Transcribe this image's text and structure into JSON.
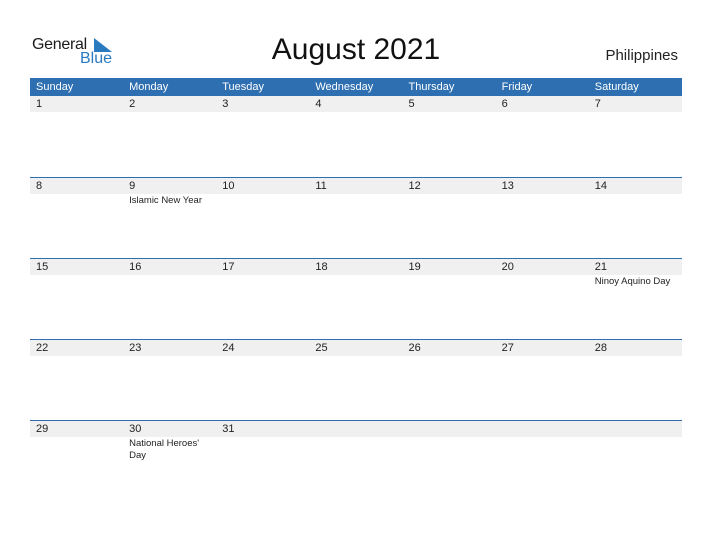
{
  "logo": {
    "general": "General",
    "blue": "Blue"
  },
  "title": "August 2021",
  "country": "Philippines",
  "colors": {
    "accent": "#2e6fb1",
    "band": "#f0f0f0"
  },
  "weekdays": [
    "Sunday",
    "Monday",
    "Tuesday",
    "Wednesday",
    "Thursday",
    "Friday",
    "Saturday"
  ],
  "weeks": [
    [
      {
        "d": "1",
        "e": ""
      },
      {
        "d": "2",
        "e": ""
      },
      {
        "d": "3",
        "e": ""
      },
      {
        "d": "4",
        "e": ""
      },
      {
        "d": "5",
        "e": ""
      },
      {
        "d": "6",
        "e": ""
      },
      {
        "d": "7",
        "e": ""
      }
    ],
    [
      {
        "d": "8",
        "e": ""
      },
      {
        "d": "9",
        "e": "Islamic New Year"
      },
      {
        "d": "10",
        "e": ""
      },
      {
        "d": "11",
        "e": ""
      },
      {
        "d": "12",
        "e": ""
      },
      {
        "d": "13",
        "e": ""
      },
      {
        "d": "14",
        "e": ""
      }
    ],
    [
      {
        "d": "15",
        "e": ""
      },
      {
        "d": "16",
        "e": ""
      },
      {
        "d": "17",
        "e": ""
      },
      {
        "d": "18",
        "e": ""
      },
      {
        "d": "19",
        "e": ""
      },
      {
        "d": "20",
        "e": ""
      },
      {
        "d": "21",
        "e": "Ninoy Aquino Day"
      }
    ],
    [
      {
        "d": "22",
        "e": ""
      },
      {
        "d": "23",
        "e": ""
      },
      {
        "d": "24",
        "e": ""
      },
      {
        "d": "25",
        "e": ""
      },
      {
        "d": "26",
        "e": ""
      },
      {
        "d": "27",
        "e": ""
      },
      {
        "d": "28",
        "e": ""
      }
    ],
    [
      {
        "d": "29",
        "e": ""
      },
      {
        "d": "30",
        "e": "National Heroes' Day"
      },
      {
        "d": "31",
        "e": ""
      },
      {
        "d": "",
        "e": ""
      },
      {
        "d": "",
        "e": ""
      },
      {
        "d": "",
        "e": ""
      },
      {
        "d": "",
        "e": ""
      }
    ]
  ]
}
